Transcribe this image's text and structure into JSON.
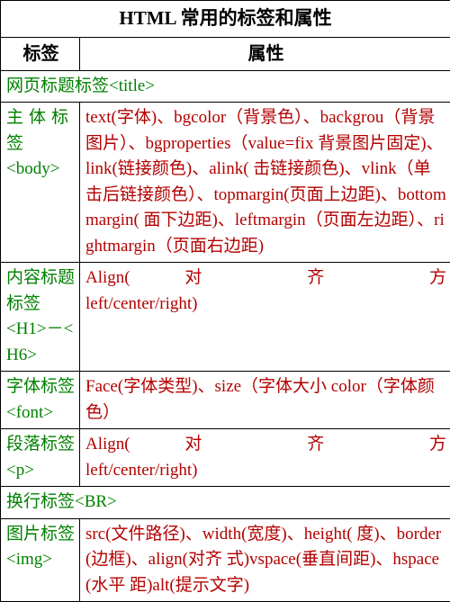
{
  "title": "HTML 常用的标签和属性",
  "headers": {
    "col1": "标签",
    "col2": "属性"
  },
  "rows": [
    {
      "tag_a": "网页标题标签",
      "tag_b": "<title>",
      "attr": "",
      "tag_span": 2
    },
    {
      "tag_a": "主体标签",
      "tag_b": "<body>",
      "attr": "text(字体)、bgcolor（背景色）、backgrou（背景图片）、bgproperties（value=fix 背景图片固定)、link(链接颜色)、alink( 击链接颜色)、vlink（单击后链接颜色）、topmargin(页面上边距)、bottommargin( 面下边距)、leftmargin（页面左边距）、rightmargin（页面右边距)"
    },
    {
      "tag_a": "内容标题标签",
      "tag_b": "<H1>－<H6>",
      "attr_line1": "Align(    对    齐    方",
      "attr_line2": "left/center/right)",
      "tag_span": 2,
      "two_line_attr": true
    },
    {
      "tag_a": "字体标签<font>",
      "tag_b": "",
      "attr": "Face(字体类型)、size（字体大小 color（字体颜色）",
      "tag_span": 2
    },
    {
      "tag_a": "段落标签<p>",
      "tag_b": "",
      "attr_line1": "Align(    对    齐    方",
      "attr_line2": "left/center/right)",
      "tag_span": 2,
      "two_line_attr": true
    },
    {
      "tag_a": "换行标签<BR>",
      "tag_b": "",
      "attr": "",
      "tag_span": 2
    },
    {
      "tag_a": "图片标签",
      "tag_b": "<img>",
      "attr": "src(文件路径)、width(宽度)、height( 度)、border(边框)、align(对齐 式)vspace(垂直间距)、hspace(水平 距)alt(提示文字)"
    }
  ]
}
